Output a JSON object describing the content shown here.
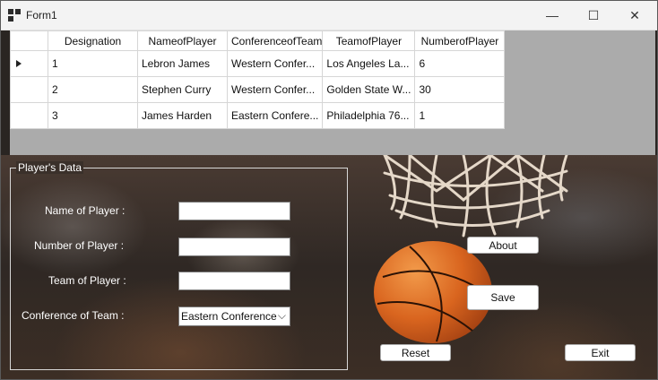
{
  "window": {
    "title": "Form1",
    "minimize_glyph": "—",
    "maximize_glyph": "☐",
    "close_glyph": "✕"
  },
  "grid": {
    "columns": [
      "Designation",
      "NameofPlayer",
      "ConferenceofTeam",
      "TeamofPlayer",
      "NumberofPlayer"
    ],
    "rows": [
      [
        "1",
        "Lebron James",
        "Western Confer...",
        "Los Angeles La...",
        "6"
      ],
      [
        "2",
        "Stephen Curry",
        "Western Confer...",
        "Golden State W...",
        "30"
      ],
      [
        "3",
        "James Harden",
        "Eastern Confere...",
        "Philadelphia 76...",
        "1"
      ]
    ],
    "current_row_index": 0
  },
  "form": {
    "group_title": "Player's Data",
    "name_label": "Name of Player :",
    "number_label": "Number of Player :",
    "team_label": "Team of Player :",
    "conference_label": "Conference of Team :",
    "name_value": "",
    "number_value": "",
    "team_value": "",
    "conference_selected": "Eastern Conference"
  },
  "buttons": {
    "about": "About",
    "save": "Save",
    "reset": "Reset",
    "exit": "Exit"
  },
  "icons": {
    "app": "app-icon",
    "row_pointer": "row-pointer-icon",
    "dropdown": "chevron-down-icon"
  }
}
